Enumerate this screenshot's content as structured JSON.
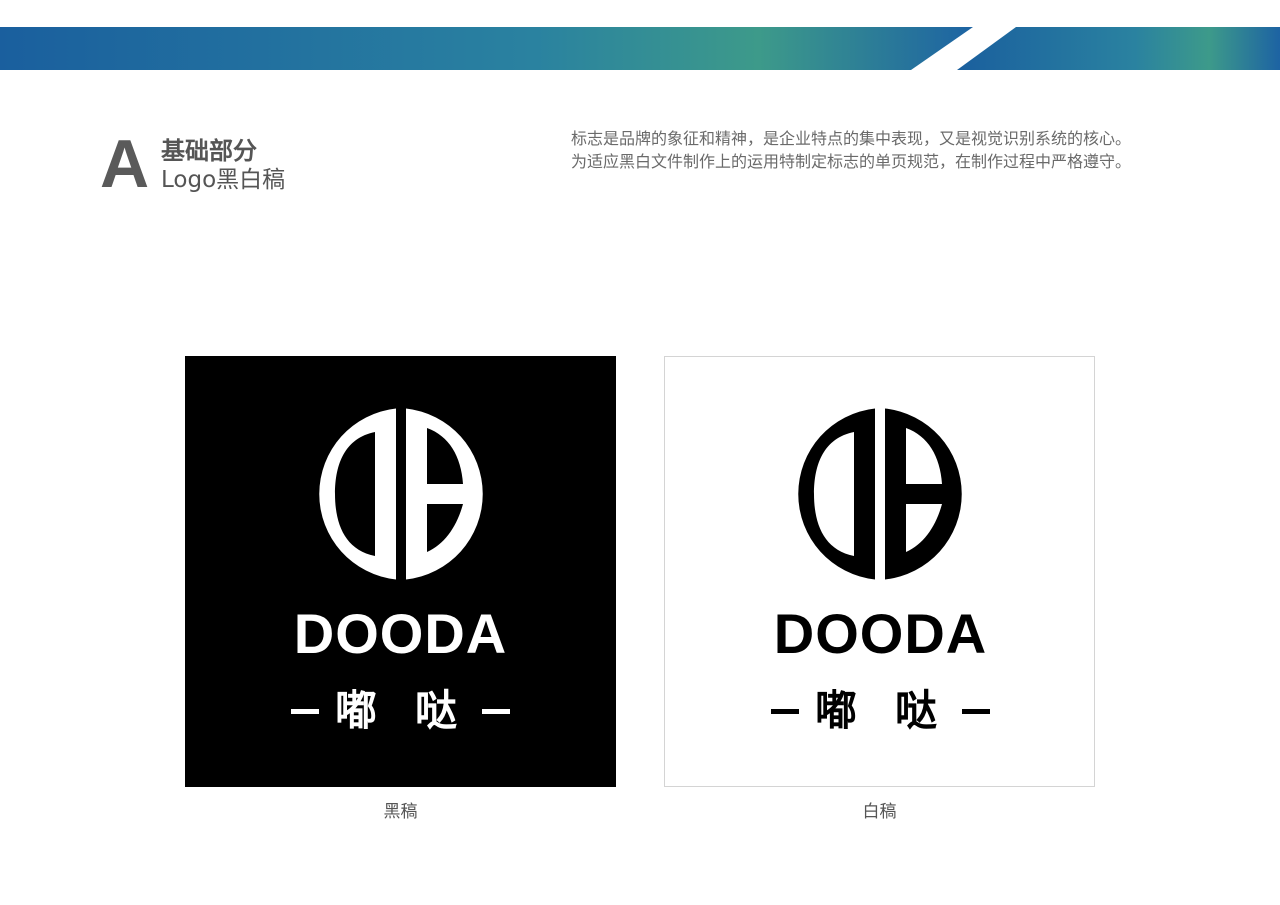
{
  "header": {
    "section_letter": "A",
    "section_title": "基础部分",
    "section_subtitle": "Logo黑白稿",
    "description_lines": [
      "标志是品牌的象征和精神，是企业特点的集中表现，又是视觉识别系统的核心。",
      "为适应黑白文件制作上的运用特制定标志的单页规范，在制作过程中严格遵守。"
    ]
  },
  "logos": {
    "black": {
      "wordmark": "DOODA",
      "cn_chars": [
        "嘟",
        "哒"
      ],
      "caption": "黑稿"
    },
    "white": {
      "wordmark": "DOODA",
      "cn_chars": [
        "嘟",
        "哒"
      ],
      "caption": "白稿"
    }
  },
  "colors": {
    "band_blue": "#1a5f9e",
    "band_teal": "#3d9a8a",
    "text_gray": "#555555"
  }
}
